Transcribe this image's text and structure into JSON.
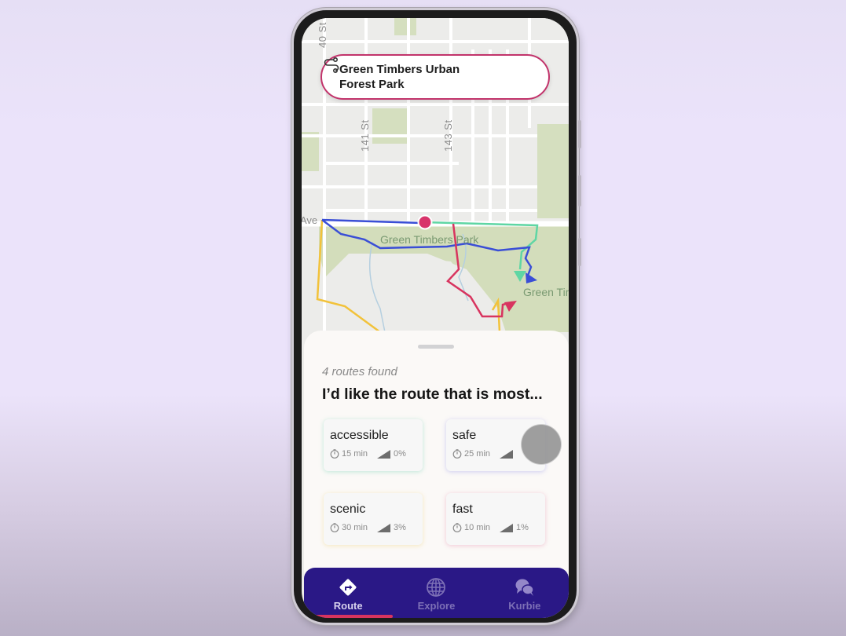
{
  "search": {
    "destination": "Green Timbers Urban Forest Park",
    "icon": "route-icon"
  },
  "map": {
    "street_labels": [
      "40 St",
      "141 St",
      "143 St",
      "Ave"
    ],
    "park_labels": [
      "Green Timbers Park",
      "Green Timbers Urban Park"
    ],
    "route_colors": {
      "accessible": "#5fd6a4",
      "safe": "#3a4ed6",
      "scenic": "#f2c23a",
      "fast": "#d8345f"
    },
    "origin_marker_color": "#d8346b"
  },
  "sheet": {
    "routes_found": "4 routes found",
    "prompt": "I’d like the route that is most...",
    "routes": [
      {
        "name": "accessible",
        "time": "15 min",
        "grade": "0%"
      },
      {
        "name": "safe",
        "time": "25 min",
        "grade": ""
      },
      {
        "name": "scenic",
        "time": "30 min",
        "grade": "3%"
      },
      {
        "name": "fast",
        "time": "10 min",
        "grade": "1%"
      }
    ]
  },
  "nav": {
    "items": [
      {
        "label": "Route",
        "icon": "route-sign-icon",
        "active": true
      },
      {
        "label": "Explore",
        "icon": "globe-icon",
        "active": false
      },
      {
        "label": "Kurbie",
        "icon": "chat-bubbles-icon",
        "active": false
      }
    ],
    "bg_color": "#2a1886",
    "indicator_color": "#d8345f"
  }
}
